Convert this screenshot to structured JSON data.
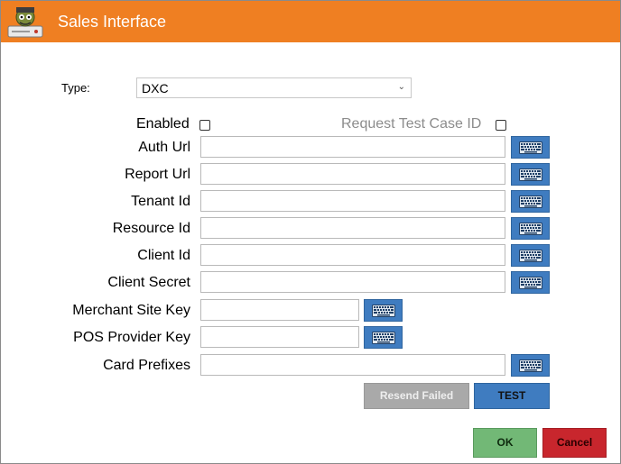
{
  "window": {
    "title": "Sales Interface"
  },
  "type": {
    "label": "Type:",
    "selected": "DXC"
  },
  "enabled": {
    "label": "Enabled",
    "checked": false
  },
  "request_test_case": {
    "label": "Request Test Case ID",
    "checked": false
  },
  "fields": {
    "auth_url": {
      "label": "Auth Url",
      "value": ""
    },
    "report_url": {
      "label": "Report Url",
      "value": ""
    },
    "tenant_id": {
      "label": "Tenant Id",
      "value": ""
    },
    "resource_id": {
      "label": "Resource Id",
      "value": ""
    },
    "client_id": {
      "label": "Client Id",
      "value": ""
    },
    "client_secret": {
      "label": "Client Secret",
      "value": ""
    },
    "merchant_site_key": {
      "label": "Merchant Site Key",
      "value": ""
    },
    "pos_provider_key": {
      "label": "POS Provider Key",
      "value": ""
    },
    "card_prefixes": {
      "label": "Card Prefixes",
      "value": ""
    }
  },
  "buttons": {
    "resend_failed": "Resend Failed",
    "test": "TEST",
    "ok": "OK",
    "cancel": "Cancel"
  },
  "colors": {
    "titlebar": "#ef7f22",
    "keyboard_button": "#3f7cc0",
    "ok": "#72b876",
    "cancel": "#c8262d",
    "disabled_button": "#a9a9a9"
  },
  "icons": {
    "keyboard_button": "keyboard-icon",
    "type_dropdown": "chevron-down-icon",
    "app": "app-icon"
  }
}
